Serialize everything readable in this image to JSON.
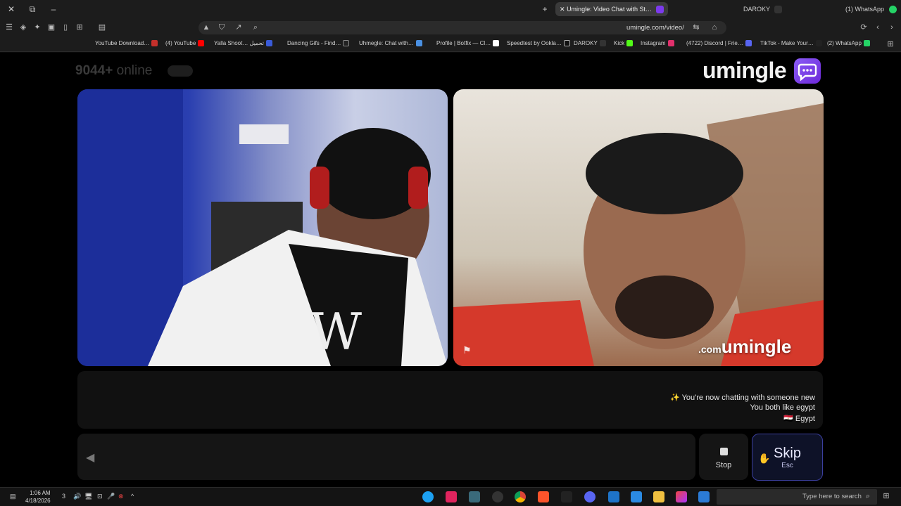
{
  "browser": {
    "tabs": [
      {
        "label": "(1) WhatsApp"
      },
      {
        "label": "DAROKY"
      },
      {
        "label": "Umingle: Video Chat with St…",
        "active": true
      }
    ],
    "url": "umingle.com/video/",
    "bookmarks": [
      "(2) WhatsApp",
      "TikTok - Make Your…",
      "(4722) Discord | Frie…",
      "Instagram",
      "Kick",
      "DAROKY",
      "Speedtest by Ookla…",
      "Profile | Botfix — Cl…",
      "Uhmegle: Chat with…",
      "Dancing Gifs - Find…",
      "Yalla Shoot… تحميل",
      "(4) YouTube",
      "YouTube Download…"
    ]
  },
  "site": {
    "online_count": "9044+",
    "online_label": "online",
    "logo_text": "umingle",
    "watermark": "umingle",
    "watermark_tld": ".com"
  },
  "chat": {
    "messages": [
      "✨ You're now chatting with someone new",
      "You both like egypt",
      "🇪🇬 Egypt"
    ],
    "input_placeholder": ""
  },
  "controls": {
    "stop_label": "Stop",
    "skip_label": "Skip",
    "skip_key": "Esc"
  },
  "taskbar": {
    "search_placeholder": "Type here to search",
    "time": "1:06 AM",
    "date": "4/18/2026",
    "notification_count": "3"
  },
  "colors": {
    "accent": "#7c3aed",
    "skip_border": "#3b3f9e"
  }
}
